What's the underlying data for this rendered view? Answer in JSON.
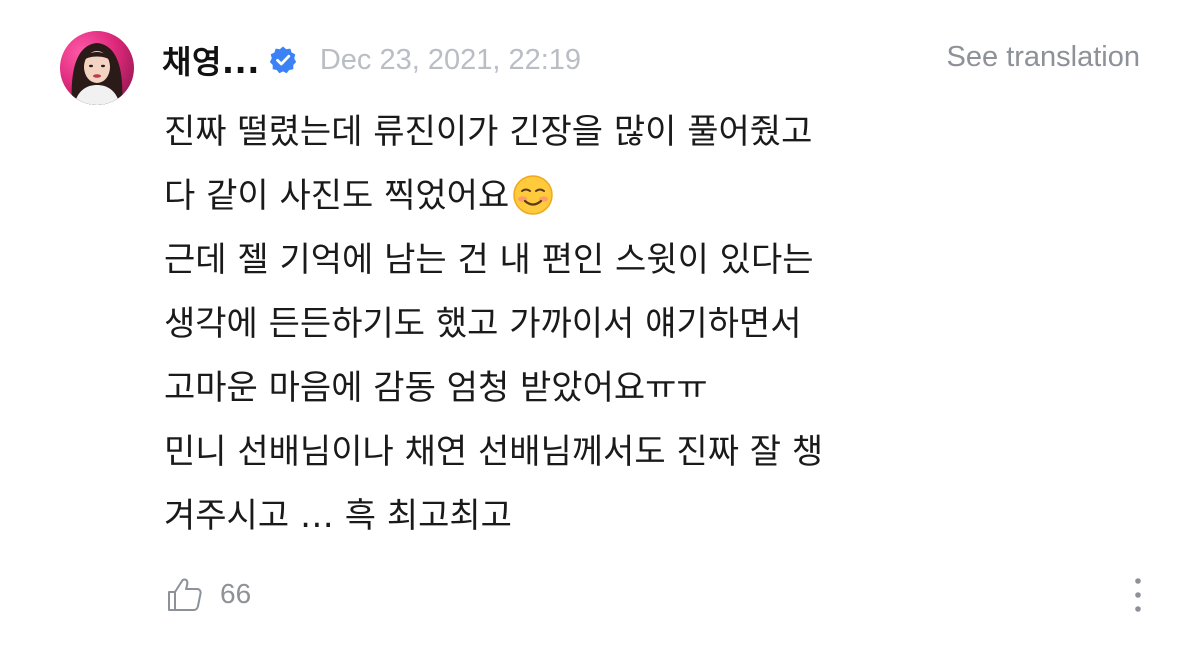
{
  "post": {
    "author": "채영...",
    "verified": true,
    "timestamp": "Dec 23, 2021, 22:19",
    "translate_label": "See translation",
    "lines": [
      "진짜 떨렸는데 류진이가 긴장을 많이 풀어줬고",
      "다 같이 사진도 찍었어요",
      "근데 젤 기억에 남는 건 내 편인 스윗이 있다는",
      "생각에 든든하기도 했고 가까이서 얘기하면서",
      "고마운 마음에 감동 엄청 받았어요ㅠㅠ",
      "민니 선배님이나 채연 선배님께서도 진짜 잘 챙",
      "겨주시고 … 흑 최고최고"
    ],
    "emoji": "smiling-face-with-blush",
    "like_count": "66"
  },
  "icons": {
    "verified": "verified-check-icon",
    "like": "thumbs-up-icon",
    "more": "more-vertical-icon"
  },
  "colors": {
    "verified_blue": "#3b82f6",
    "muted_text": "#8d9198",
    "timestamp_text": "#b9bdc4"
  }
}
